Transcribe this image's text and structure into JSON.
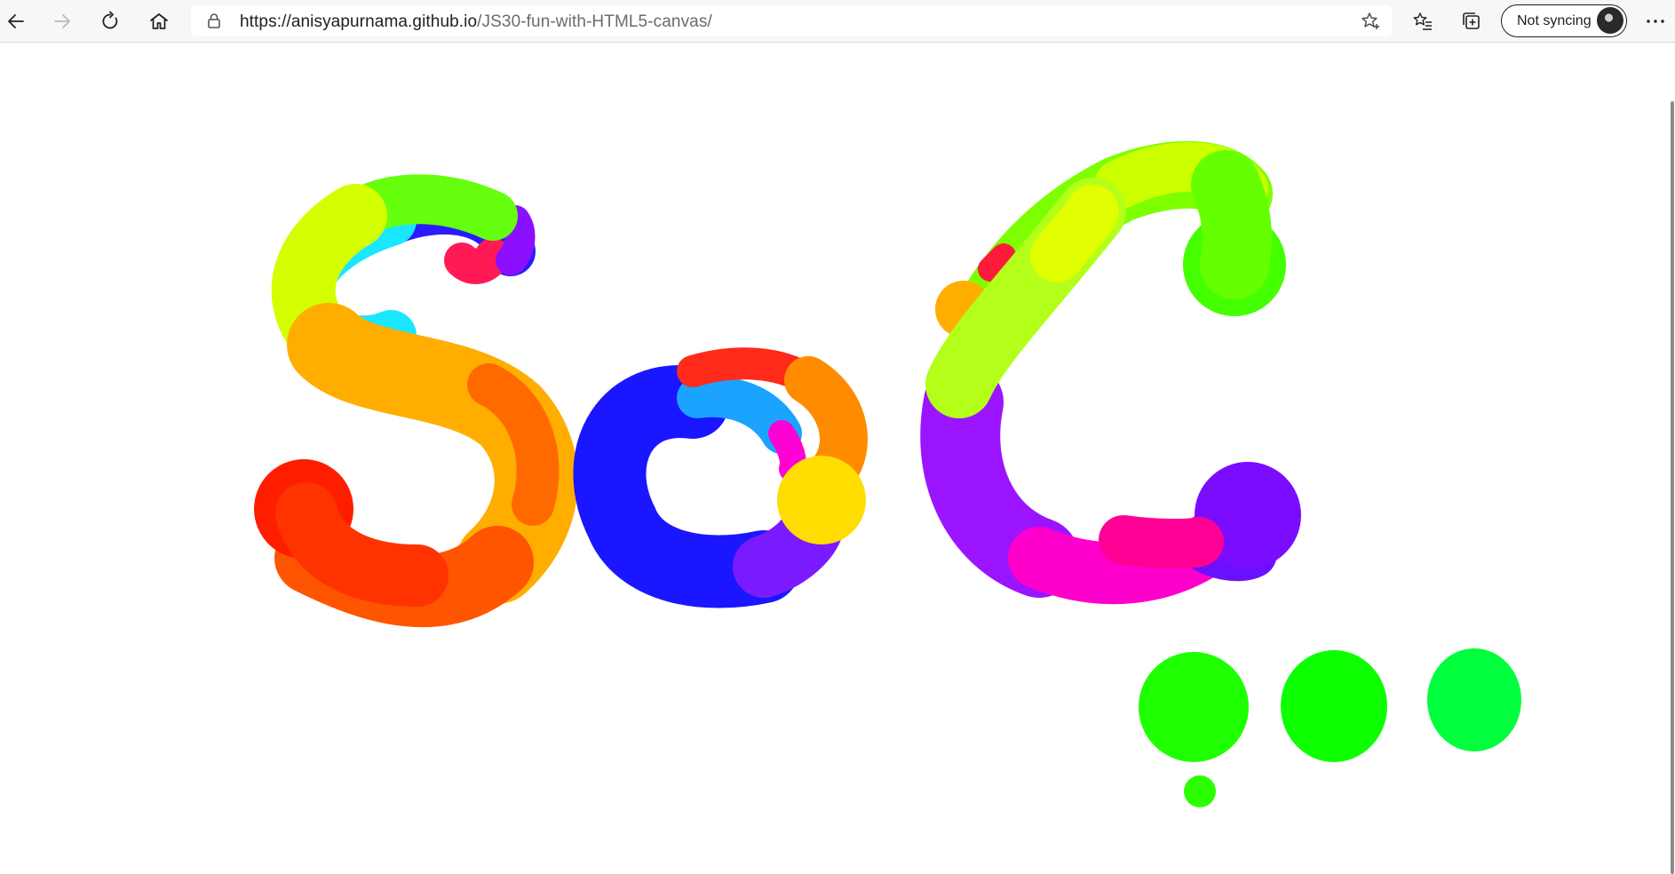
{
  "browser": {
    "url_host": "https://anisyapurnama.github.io",
    "url_path": "/JS30-fun-with-HTML5-canvas/",
    "sync_label": "Not syncing"
  },
  "icons": {
    "back": "back-arrow-icon",
    "forward": "forward-arrow-icon",
    "refresh": "refresh-icon",
    "home": "home-icon",
    "lock": "lock-icon",
    "favorite": "star-add-icon",
    "favorites_list": "favorites-icon",
    "collections": "collections-icon",
    "profile": "avatar",
    "more": "more-icon"
  },
  "canvas": {
    "drawing": "rainbow brush strokes forming S, o, C and dots"
  }
}
